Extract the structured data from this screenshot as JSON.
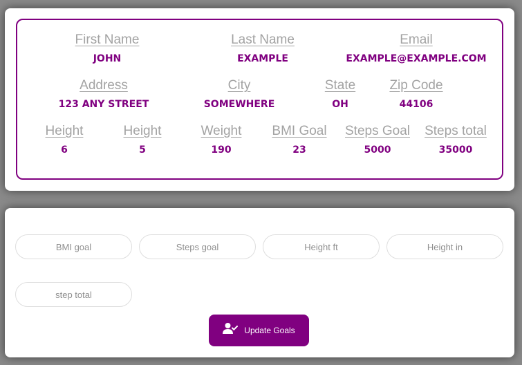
{
  "profile": {
    "row1": [
      {
        "label": "First Name",
        "value": "JOHN"
      },
      {
        "label": "Last Name",
        "value": "EXAMPLE"
      },
      {
        "label": "Email",
        "value": "EXAMPLE@EXAMPLE.COM"
      }
    ],
    "row2": [
      {
        "label": "Address",
        "value": "123 ANY STREET"
      },
      {
        "label": "City",
        "value": "SOMEWHERE"
      },
      {
        "label": "State",
        "value": "OH"
      },
      {
        "label": "Zip Code",
        "value": "44106"
      }
    ],
    "row3": [
      {
        "label": "Height",
        "value": "6"
      },
      {
        "label": "Height",
        "value": "5"
      },
      {
        "label": "Weight",
        "value": "190"
      },
      {
        "label": "BMI Goal",
        "value": "23"
      },
      {
        "label": "Steps Goal",
        "value": "5000"
      },
      {
        "label": "Steps total",
        "value": "35000"
      }
    ]
  },
  "goals_form": {
    "inputs": [
      {
        "placeholder": "BMI goal",
        "value": ""
      },
      {
        "placeholder": "Steps goal",
        "value": ""
      },
      {
        "placeholder": "Height ft",
        "value": ""
      },
      {
        "placeholder": "Height in",
        "value": ""
      },
      {
        "placeholder": "step total",
        "value": ""
      }
    ],
    "submit_label": "Update Goals",
    "submit_icon": "user-check-icon"
  },
  "colors": {
    "accent": "#800080",
    "label": "#a3a3a3",
    "placeholder": "#8f8f8f",
    "backdrop": "#8a8a8a"
  }
}
